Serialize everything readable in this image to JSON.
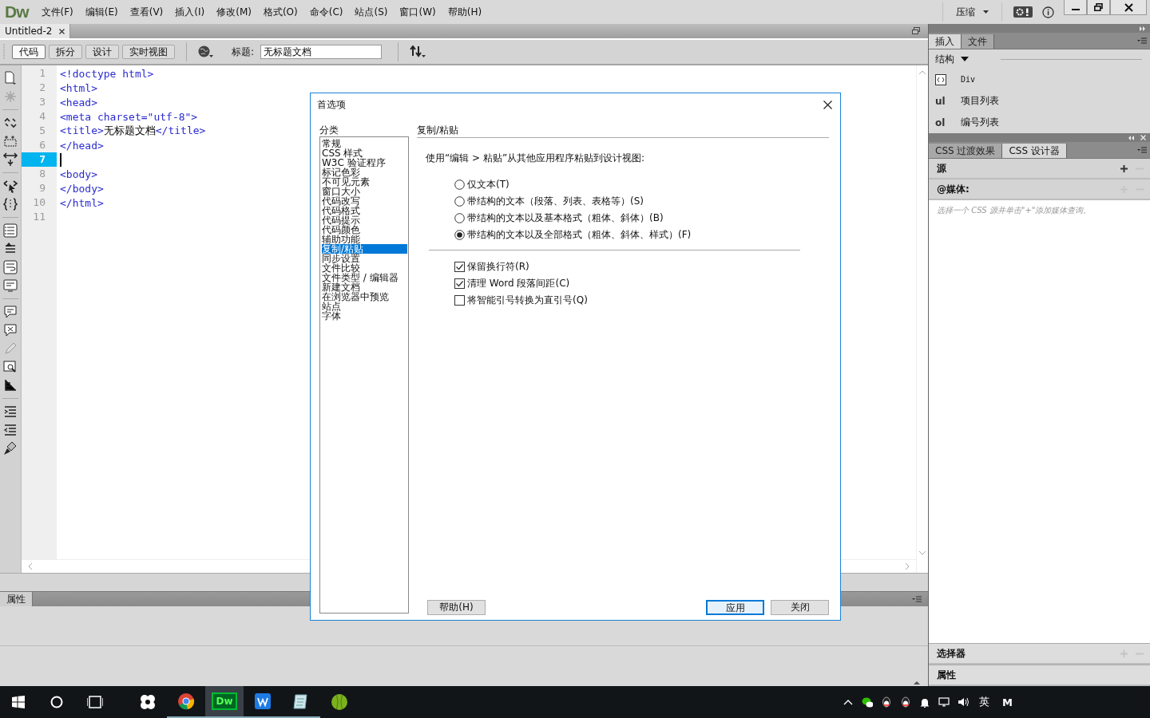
{
  "app": {
    "logo": "Dw",
    "compress": "压缩"
  },
  "menus": [
    "文件(F)",
    "编辑(E)",
    "查看(V)",
    "插入(I)",
    "修改(M)",
    "格式(O)",
    "命令(C)",
    "站点(S)",
    "窗口(W)",
    "帮助(H)"
  ],
  "document_tabs": [
    {
      "label": "Untitled-2",
      "selected": true
    }
  ],
  "view_buttons": [
    {
      "label": "代码",
      "selected": true
    },
    {
      "label": "拆分",
      "selected": false
    },
    {
      "label": "设计",
      "selected": false
    },
    {
      "label": "实时视图",
      "selected": false
    }
  ],
  "title_field": {
    "label": "标题:",
    "value": "无标题文档"
  },
  "code_lines": [
    {
      "number": "1",
      "current": false,
      "parts": [
        {
          "kind": "tag",
          "text": "<!doctype html>"
        }
      ]
    },
    {
      "number": "2",
      "current": false,
      "parts": [
        {
          "kind": "tag",
          "text": "<html>"
        }
      ]
    },
    {
      "number": "3",
      "current": false,
      "parts": [
        {
          "kind": "tag",
          "text": "<head>"
        }
      ]
    },
    {
      "number": "4",
      "current": false,
      "parts": [
        {
          "kind": "tag",
          "text": "<meta charset=\"utf-8\">"
        }
      ]
    },
    {
      "number": "5",
      "current": false,
      "parts": [
        {
          "kind": "tag",
          "text": "<title>"
        },
        {
          "kind": "text",
          "text": "无标题文档"
        },
        {
          "kind": "tag",
          "text": "</title>"
        }
      ]
    },
    {
      "number": "6",
      "current": false,
      "parts": [
        {
          "kind": "tag",
          "text": "</head>"
        }
      ]
    },
    {
      "number": "7",
      "current": true
    },
    {
      "number": "8",
      "current": false,
      "parts": [
        {
          "kind": "tag",
          "text": "<body>"
        }
      ]
    },
    {
      "number": "9",
      "current": false,
      "parts": [
        {
          "kind": "tag",
          "text": "</body>"
        }
      ]
    },
    {
      "number": "10",
      "current": false,
      "parts": [
        {
          "kind": "tag",
          "text": "</html>"
        }
      ]
    },
    {
      "number": "11",
      "current": false
    }
  ],
  "properties_panel": {
    "tab": "属性"
  },
  "insert_panel": {
    "tabs": [
      {
        "label": "插入",
        "selected": true
      },
      {
        "label": "文件",
        "selected": false
      }
    ],
    "category": "结构",
    "items": [
      {
        "kind": "icon",
        "label": "Div"
      },
      {
        "kind": "mark",
        "mark": "ul",
        "label": "项目列表"
      },
      {
        "kind": "mark",
        "mark": "ol",
        "label": "编号列表"
      }
    ]
  },
  "css_panel": {
    "tabs": [
      {
        "label": "CSS 过渡效果",
        "selected": false
      },
      {
        "label": "CSS 设计器",
        "selected": true
      }
    ],
    "sources": "源",
    "media": "@媒体:",
    "hint": "选择一个 CSS 源并单击\"+\"添加媒体查询。",
    "selectors": "选择器",
    "properties": "属性"
  },
  "dialog": {
    "title": "首选项",
    "category_label": "分类",
    "categories": [
      {
        "label": "常规",
        "selected": false
      },
      {
        "label": "CSS 样式",
        "selected": false
      },
      {
        "label": "W3C 验证程序",
        "selected": false
      },
      {
        "label": "标记色彩",
        "selected": false
      },
      {
        "label": "不可见元素",
        "selected": false
      },
      {
        "label": "窗口大小",
        "selected": false
      },
      {
        "label": "代码改写",
        "selected": false
      },
      {
        "label": "代码格式",
        "selected": false
      },
      {
        "label": "代码提示",
        "selected": false
      },
      {
        "label": "代码颜色",
        "selected": false
      },
      {
        "label": "辅助功能",
        "selected": false
      },
      {
        "label": "复制/粘贴",
        "selected": true
      },
      {
        "label": "同步设置",
        "selected": false
      },
      {
        "label": "文件比较",
        "selected": false
      },
      {
        "label": "文件类型 / 编辑器",
        "selected": false
      },
      {
        "label": "新建文档",
        "selected": false
      },
      {
        "label": "在浏览器中预览",
        "selected": false
      },
      {
        "label": "站点",
        "selected": false
      },
      {
        "label": "字体",
        "selected": false
      }
    ],
    "section_title": "复制/粘贴",
    "prompt": "使用“编辑 > 粘贴”从其他应用程序粘贴到设计视图:",
    "radios": [
      {
        "label": "仅文本(T)",
        "selected": false
      },
      {
        "label": "带结构的文本（段落、列表、表格等）(S)",
        "selected": false
      },
      {
        "label": "带结构的文本以及基本格式（粗体、斜体）(B)",
        "selected": false
      },
      {
        "label": "带结构的文本以及全部格式（粗体、斜体、样式）(F)",
        "selected": true
      }
    ],
    "checkboxes": [
      {
        "label": "保留换行符(R)",
        "checked": true
      },
      {
        "label": "清理 Word 段落间距(C)",
        "checked": true
      },
      {
        "label": "将智能引号转换为直引号(Q)",
        "checked": false
      }
    ],
    "buttons": [
      {
        "label": "帮助(H)",
        "default": false
      },
      {
        "label": "应用",
        "default": true
      },
      {
        "label": "关闭",
        "default": false
      }
    ]
  },
  "taskbar": {
    "apps": [
      {
        "kind": "pinwheel",
        "running": false,
        "selected": false
      },
      {
        "kind": "browser",
        "running": true,
        "selected": false
      },
      {
        "kind": "dw",
        "label": "Dw",
        "running": true,
        "selected": true
      },
      {
        "kind": "blue-app",
        "running": true,
        "selected": false
      },
      {
        "kind": "notepad",
        "running": true,
        "selected": false
      },
      {
        "kind": "green-ball",
        "running": false,
        "selected": false
      }
    ],
    "input_method": "英",
    "ime_mode": "M"
  }
}
